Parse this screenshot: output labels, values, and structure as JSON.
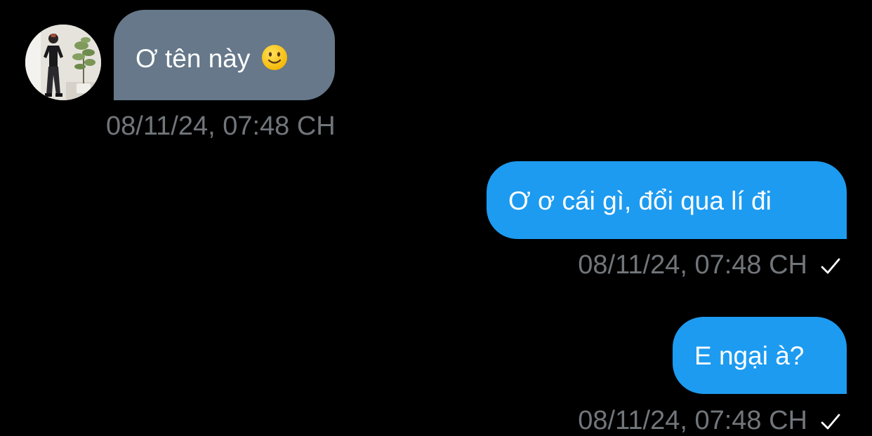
{
  "conversation": {
    "messages": [
      {
        "direction": "received",
        "text": "Ơ tên này",
        "emoji": "slightly-smiling-face",
        "timestamp": "08/11/24, 07:48 CH"
      },
      {
        "direction": "sent",
        "text": "Ơ ơ cái gì, đổi qua lí đi",
        "timestamp": "08/11/24, 07:48 CH",
        "status_icon": "check-icon"
      },
      {
        "direction": "sent",
        "text": "E ngại à?",
        "timestamp": "08/11/24, 07:48 CH",
        "status_icon": "check-icon"
      }
    ]
  },
  "colors": {
    "background": "#000000",
    "received_bubble": "#66788a",
    "sent_bubble": "#1d9bf0",
    "timestamp": "#71767b",
    "text": "#ffffff"
  }
}
